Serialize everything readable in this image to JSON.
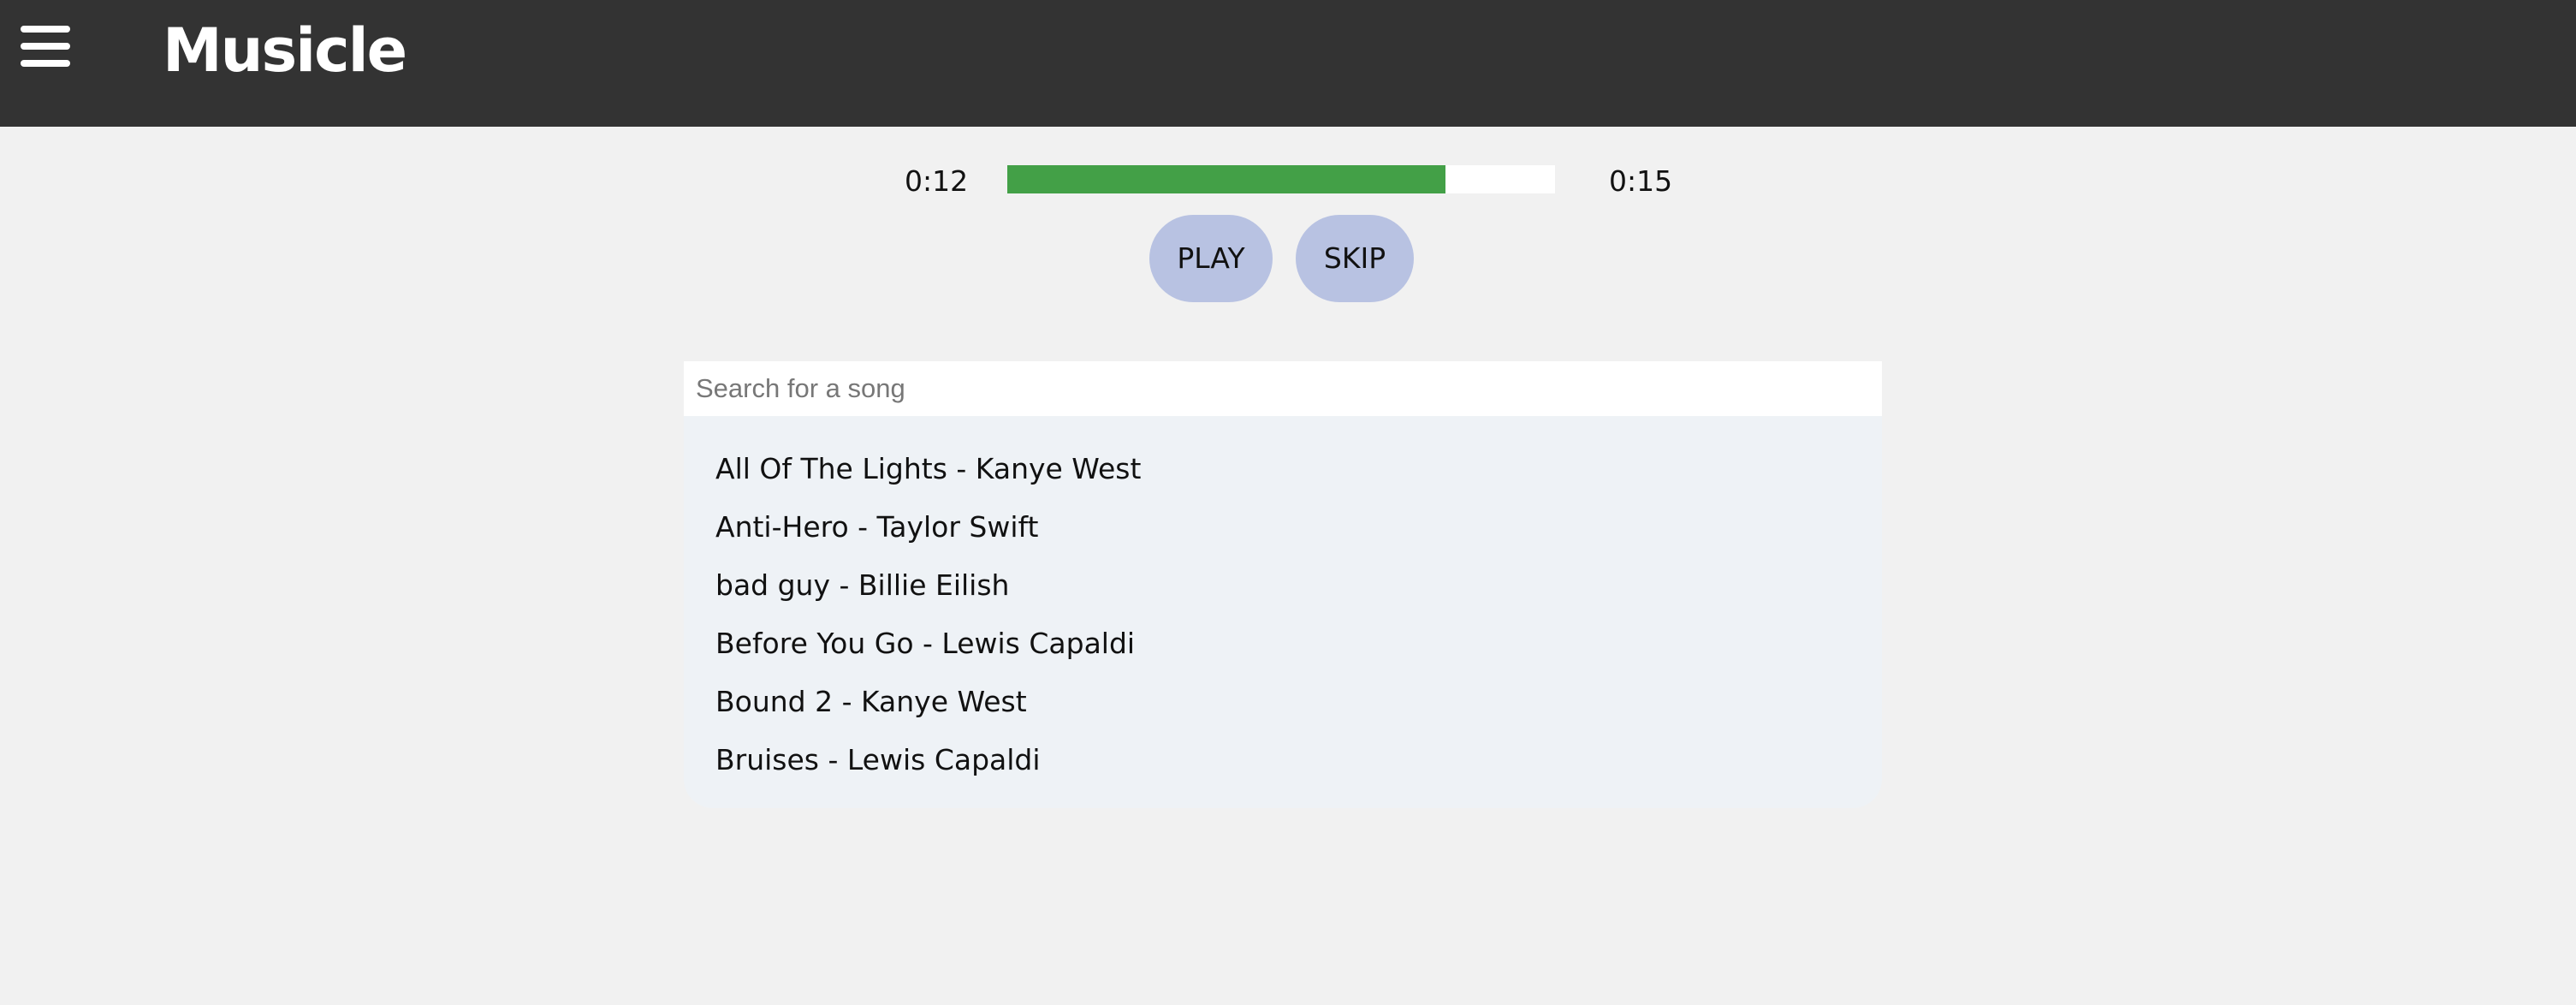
{
  "app": {
    "title": "Musicle"
  },
  "player": {
    "current_time": "0:12",
    "total_time": "0:15",
    "progress_fraction": 0.8,
    "play_label": "PLAY",
    "skip_label": "SKIP"
  },
  "search": {
    "placeholder": "Search for a song",
    "value": ""
  },
  "songs": [
    "All Of The Lights - Kanye West",
    "Anti-Hero - Taylor Swift",
    "bad guy - Billie Eilish",
    "Before You Go - Lewis Capaldi",
    "Bound 2 - Kanye West",
    "Bruises - Lewis Capaldi"
  ],
  "colors": {
    "topbar": "#333333",
    "background": "#f1f1f1",
    "progress_fill": "#43a047",
    "button": "#b8c2e2"
  },
  "icons": {
    "menu": "hamburger-menu-icon"
  }
}
